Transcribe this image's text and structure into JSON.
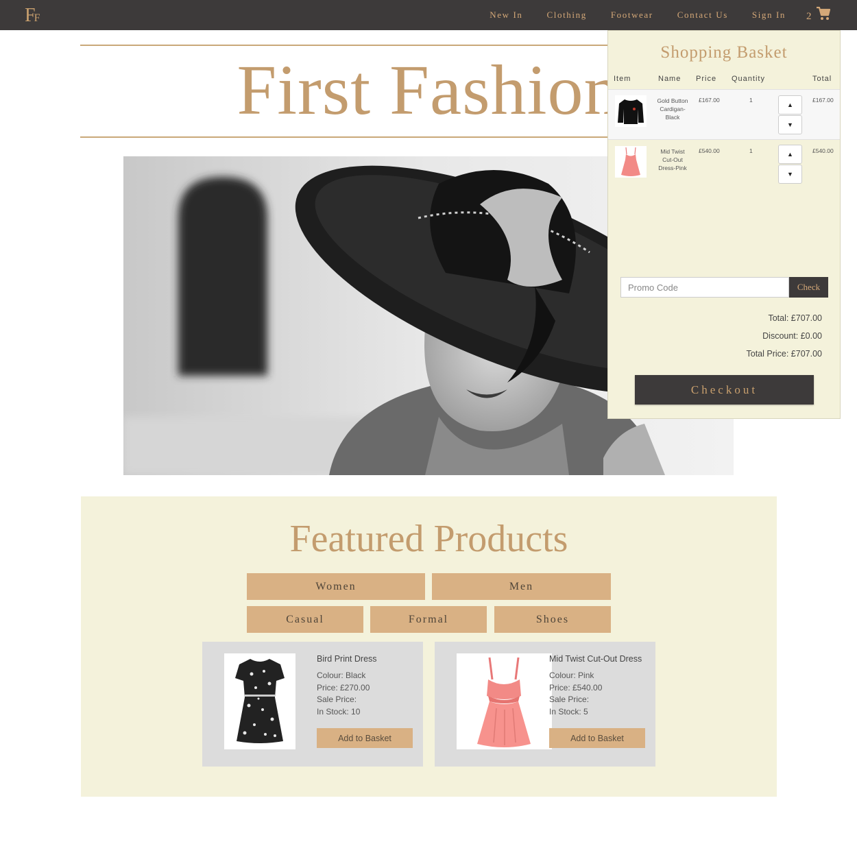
{
  "brand": {
    "logo_big": "F",
    "logo_small": "F"
  },
  "nav": {
    "items": [
      {
        "label": "New In"
      },
      {
        "label": "Clothing"
      },
      {
        "label": "Footwear"
      },
      {
        "label": "Contact Us"
      },
      {
        "label": "Sign In"
      }
    ],
    "cart_count": "2",
    "cart_icon": "shopping-cart-icon"
  },
  "hero": {
    "title": "First Fashion"
  },
  "featured": {
    "title": "Featured Products",
    "filters": [
      "Women",
      "Men",
      "Casual",
      "Formal",
      "Shoes"
    ],
    "products": [
      {
        "name": "Bird Print Dress",
        "colour": "Colour: Black",
        "price": "Price: £270.00",
        "sale_price": "Sale Price:",
        "stock": "In Stock: 10",
        "button": "Add to Basket"
      },
      {
        "name": "Mid Twist Cut-Out Dress",
        "colour": "Colour: Pink",
        "price": "Price: £540.00",
        "sale_price": "Sale Price:",
        "stock": "In Stock: 5",
        "button": "Add to Basket"
      }
    ]
  },
  "basket": {
    "title": "Shopping Basket",
    "headers": {
      "item": "Item",
      "name": "Name",
      "price": "Price",
      "quantity": "Quantity",
      "total": "Total"
    },
    "rows": [
      {
        "name": "Gold Button Cardigan-Black",
        "price": "£167.00",
        "qty": "1",
        "total": "£167.00"
      },
      {
        "name": "Mid Twist Cut-Out Dress-Pink",
        "price": "£540.00",
        "qty": "1",
        "total": "£540.00"
      }
    ],
    "promo_placeholder": "Promo Code",
    "check_label": "Check",
    "total": "Total: £707.00",
    "discount": "Discount: £0.00",
    "total_price": "Total Price: £707.00",
    "checkout_label": "Checkout"
  },
  "colors": {
    "nav_bg": "#3d3a3a",
    "gold": "#c39c6e",
    "button_tan": "#d9b184",
    "cream": "#f4f2db"
  }
}
